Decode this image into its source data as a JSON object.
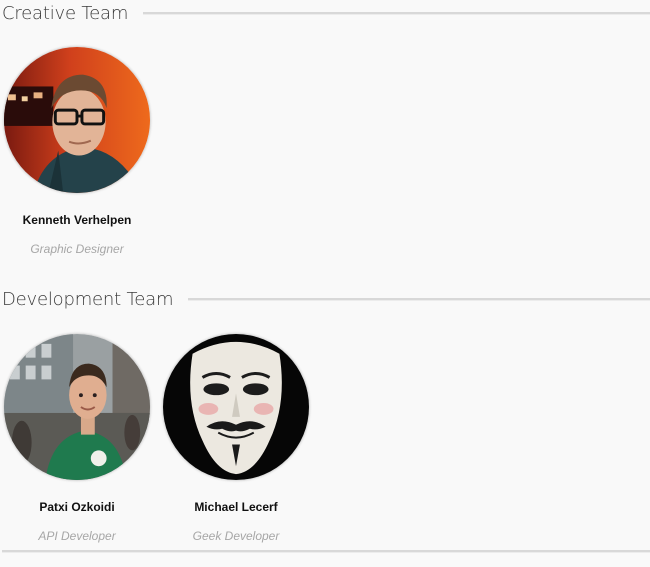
{
  "sections": [
    {
      "title": "Creative Team",
      "members": [
        {
          "name": "Kenneth Verhelpen",
          "role": "Graphic Designer",
          "avatar": "person-with-glasses-avatar"
        }
      ]
    },
    {
      "title": "Development Team",
      "members": [
        {
          "name": "Patxi Ozkoidi",
          "role": "API Developer",
          "avatar": "person-in-green-shirt-avatar"
        },
        {
          "name": "Michael Lecerf",
          "role": "Geek Developer",
          "avatar": "guy-fawkes-mask-avatar"
        }
      ]
    }
  ],
  "colors": {
    "background": "#f9f9f9",
    "heading": "#3a3a3a",
    "name": "#111111",
    "role": "#a6a6a6",
    "rule": "#d8d8d8"
  }
}
